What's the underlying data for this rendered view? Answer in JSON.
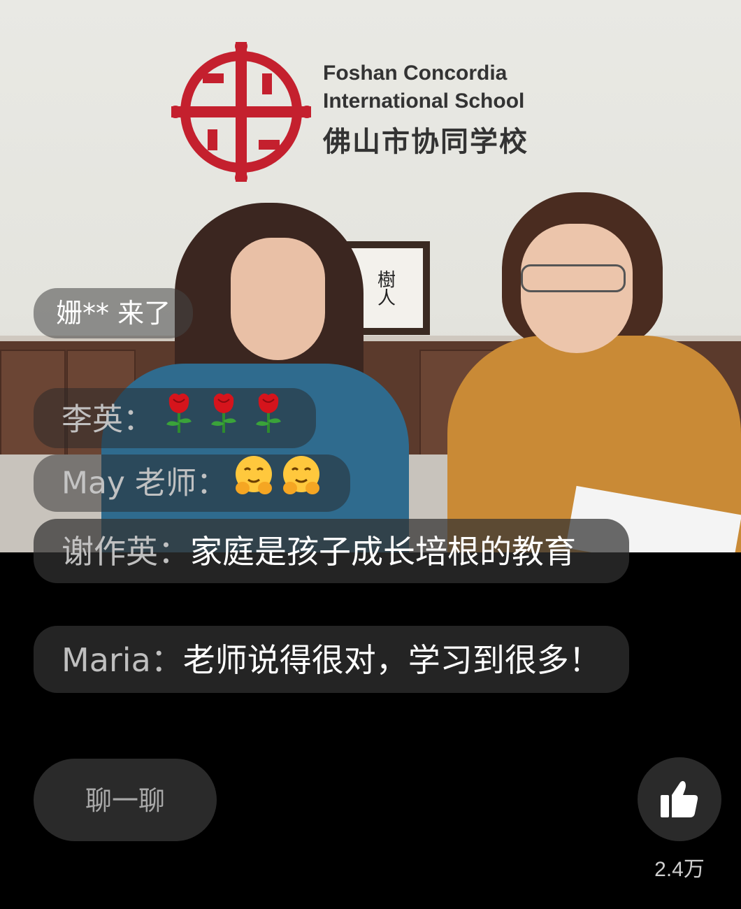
{
  "video": {
    "logo_en_line1": "Foshan Concordia",
    "logo_en_line2": "International School",
    "logo_cn": "佛山市协同学校",
    "frame_text": "樹人",
    "logo_color": "#c4202e"
  },
  "join_notice": {
    "user": "姗**",
    "text": "来了"
  },
  "comments": [
    {
      "name": "李英：",
      "text": "",
      "emoji": [
        "rose-icon",
        "rose-icon",
        "rose-icon"
      ]
    },
    {
      "name": "May 老师：",
      "text": "",
      "emoji": [
        "hugging-face-icon",
        "hugging-face-icon"
      ]
    },
    {
      "name": "谢作英：",
      "text": "家庭是孩子成长培根的教育",
      "emoji": []
    },
    {
      "name": "Maria：",
      "text": "老师说得很对，学习到很多！",
      "emoji": []
    }
  ],
  "controls": {
    "chat_label": "聊一聊",
    "like_count": "2.4万",
    "like_icon": "thumbs-up-icon"
  }
}
